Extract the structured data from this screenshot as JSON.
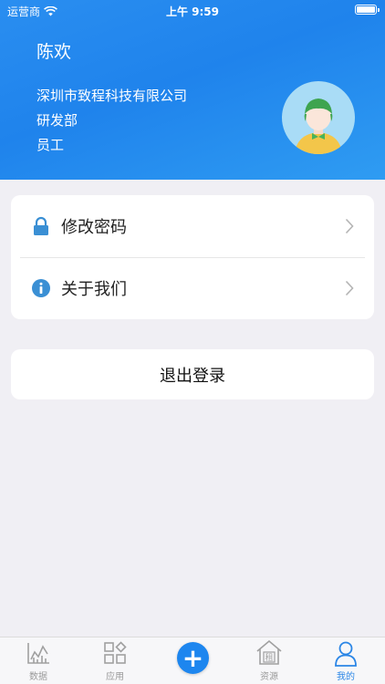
{
  "status_bar": {
    "carrier": "运营商",
    "time": "上午 9:59"
  },
  "profile": {
    "name": "陈欢",
    "company": "深圳市致程科技有限公司",
    "department": "研发部",
    "role": "员工"
  },
  "menu": [
    {
      "label": "修改密码",
      "icon": "lock-icon"
    },
    {
      "label": "关于我们",
      "icon": "info-icon"
    }
  ],
  "logout_label": "退出登录",
  "tabs": [
    {
      "label": "数据",
      "icon": "chart-icon",
      "active": false
    },
    {
      "label": "应用",
      "icon": "apps-icon",
      "active": false
    },
    {
      "label": "",
      "icon": "plus-icon",
      "active": false
    },
    {
      "label": "资源",
      "icon": "house-icon",
      "icon_text": "租",
      "active": false
    },
    {
      "label": "我的",
      "icon": "person-icon",
      "active": true
    }
  ],
  "colors": {
    "header_blue": "#1f83ec",
    "accent_blue": "#2b86e6",
    "background": "#f0eff4",
    "icon_blue": "#3a8fd4"
  }
}
